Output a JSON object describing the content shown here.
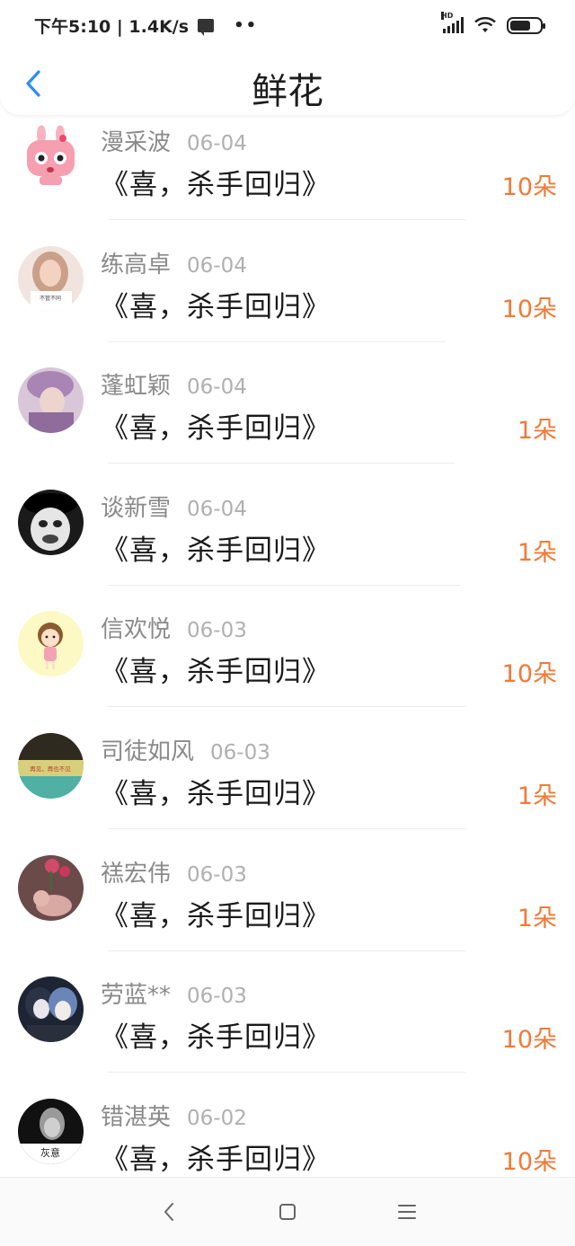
{
  "status": {
    "time_speed": "下午5:10 | 1.4K/s",
    "dots": "••",
    "signal_label": "HD"
  },
  "header": {
    "title": "鲜花"
  },
  "items": [
    {
      "name": "漫采波",
      "date": "06-04",
      "message": "《喜，杀手回归》",
      "count": "10朵",
      "avatar": "cartoon-rabbit"
    },
    {
      "name": "练高卓",
      "date": "06-04",
      "message": "《喜，杀手回归》",
      "count": "10朵",
      "avatar": "girl-photo"
    },
    {
      "name": "蓬虹颖",
      "date": "06-04",
      "message": "《喜，杀手回归》",
      "count": "1朵",
      "avatar": "girl-purple-hat"
    },
    {
      "name": "谈新雪",
      "date": "06-04",
      "message": "《喜，杀手回归》",
      "count": "1朵",
      "avatar": "clown-bw"
    },
    {
      "name": "信欢悦",
      "date": "06-03",
      "message": "《喜，杀手回归》",
      "count": "10朵",
      "avatar": "cartoon-girl"
    },
    {
      "name": "司徒如风",
      "date": "06-03",
      "message": "《喜，杀手回归》",
      "count": "1朵",
      "avatar": "sunset-text"
    },
    {
      "name": "禚宏伟",
      "date": "06-03",
      "message": "《喜，杀手回归》",
      "count": "1朵",
      "avatar": "flowers-cat"
    },
    {
      "name": "劳蓝**",
      "date": "06-03",
      "message": "《喜，杀手回归》",
      "count": "10朵",
      "avatar": "anime-boys"
    },
    {
      "name": "错湛英",
      "date": "06-02",
      "message": "《喜，杀手回归》",
      "count": "10朵",
      "avatar": "dark-portrait"
    }
  ],
  "avatar_texts": {
    "girl_photo_shirt": "不管不同",
    "sunset": "再见，再也不见",
    "dark_portrait": "灰意"
  },
  "colors": {
    "accent_blue": "#2a8cf5",
    "count_orange": "#f07a37",
    "name_gray": "#8a8a8a"
  }
}
